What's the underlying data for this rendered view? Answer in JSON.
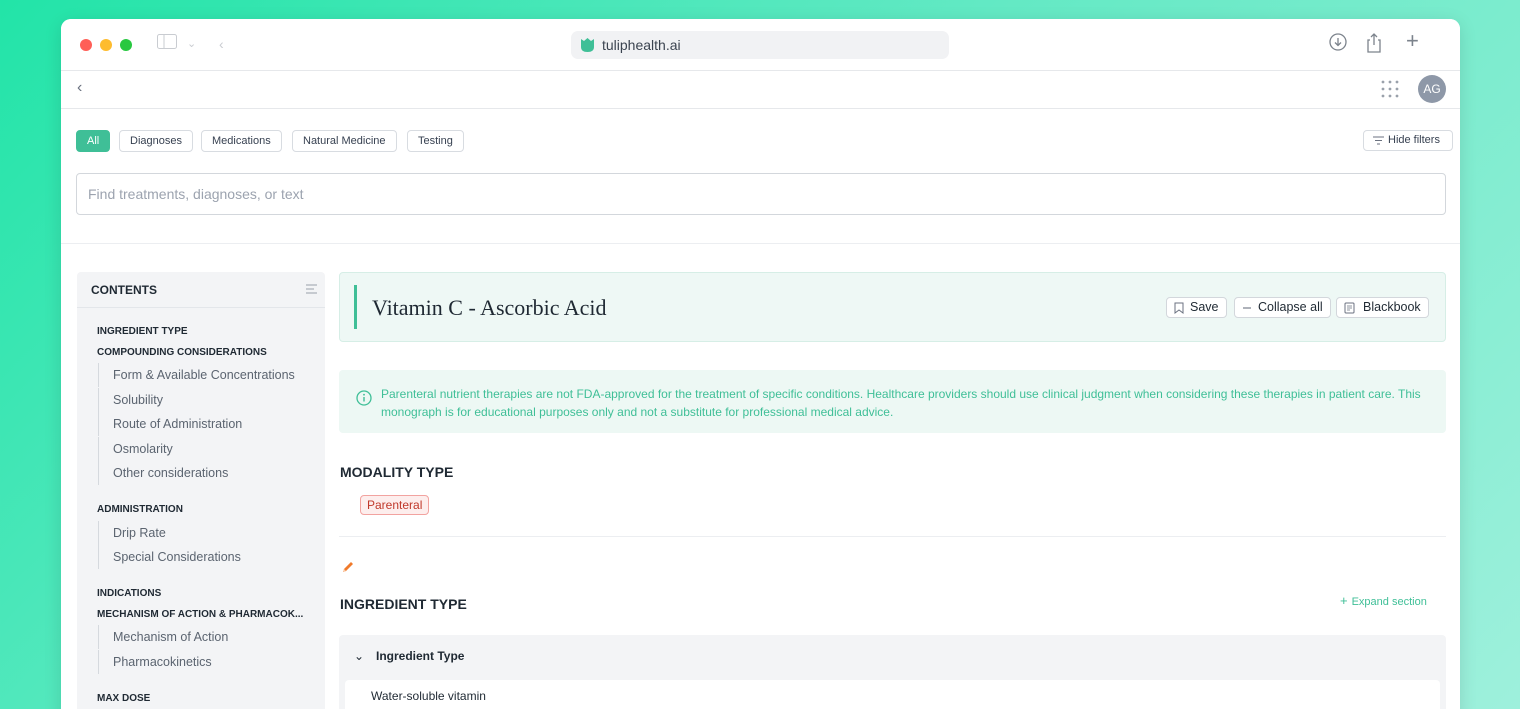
{
  "browser": {
    "url": "tuliphealth.ai",
    "icons": [
      "sidebar-toggle-icon",
      "chevron-down-icon",
      "back-icon",
      "download-icon",
      "share-icon",
      "new-tab-icon"
    ],
    "traffic_colors": [
      "#ff5f57",
      "#febc2e",
      "#28c840"
    ]
  },
  "header": {
    "avatar_initials": "AG",
    "back_icon": "chevron-left-icon"
  },
  "filters": {
    "chips": [
      "All",
      "Diagnoses",
      "Medications",
      "Natural Medicine",
      "Testing"
    ],
    "active": "All",
    "hide_label": "Hide filters"
  },
  "search": {
    "placeholder": "Find treatments, diagnoses, or text"
  },
  "sidebar": {
    "title": "CONTENTS",
    "sections": [
      {
        "label": "INGREDIENT TYPE",
        "items": []
      },
      {
        "label": "COMPOUNDING CONSIDERATIONS",
        "items": [
          "Form & Available Concentrations",
          "Solubility",
          "Route of Administration",
          "Osmolarity",
          "Other considerations"
        ]
      },
      {
        "label": "ADMINISTRATION",
        "items": [
          "Drip Rate",
          "Special Considerations"
        ]
      },
      {
        "label": "INDICATIONS",
        "items": []
      },
      {
        "label": "MECHANISM OF ACTION & PHARMACOK...",
        "items": [
          "Mechanism of Action",
          "Pharmacokinetics"
        ]
      },
      {
        "label": "MAX DOSE",
        "items": []
      }
    ]
  },
  "monograph": {
    "title": "Vitamin C - Ascorbic Acid",
    "actions": {
      "save": "Save",
      "collapse": "Collapse all",
      "blackbook": "Blackbook"
    },
    "notice": "Parenteral nutrient therapies are not FDA-approved for the treatment of specific conditions. Healthcare providers should use clinical judgment when considering these therapies in patient care. This monograph is for educational purposes only and not a substitute for professional medical advice.",
    "modality_heading": "MODALITY TYPE",
    "modality_badge": "Parenteral",
    "ingredient_heading": "INGREDIENT TYPE",
    "expand_label": "Expand section",
    "accordion": {
      "title": "Ingredient Type",
      "body": "Water-soluble vitamin"
    }
  },
  "colors": {
    "accent": "#3fbf97",
    "badge_red": "#c0392b",
    "pencil": "#f07a2b"
  }
}
